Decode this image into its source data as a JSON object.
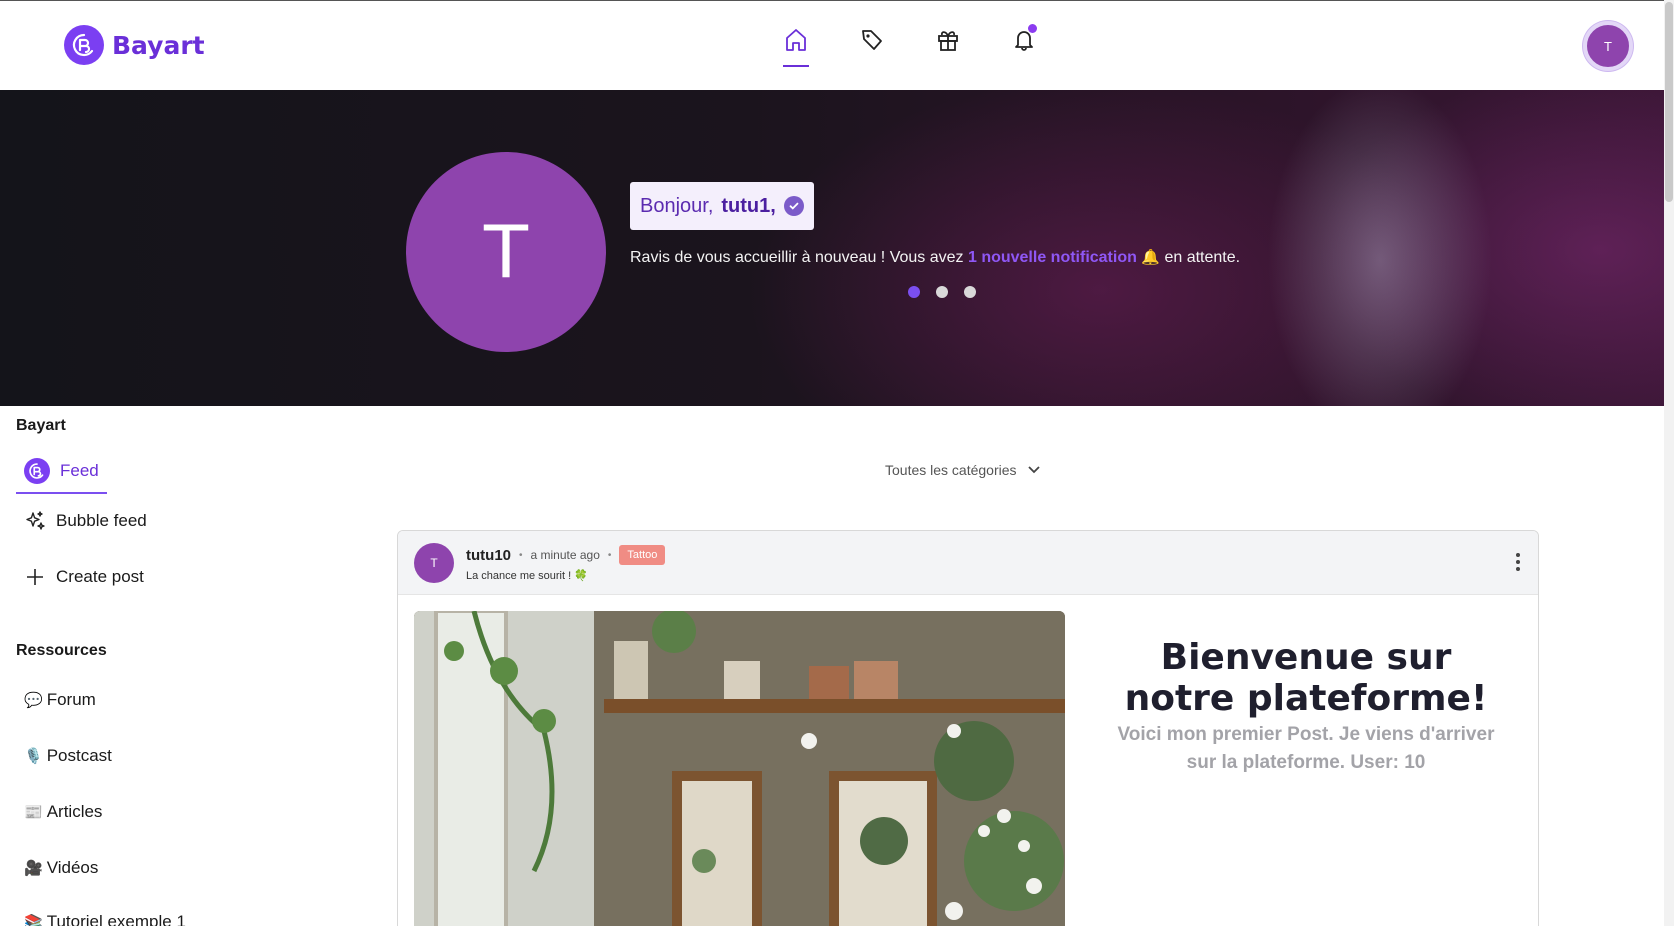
{
  "brand": {
    "name": "Bayart"
  },
  "nav": {
    "icons": [
      "home-icon",
      "tag-icon",
      "gift-icon",
      "bell-icon"
    ],
    "active": "home-icon",
    "has_notification": true
  },
  "user": {
    "initial": "T"
  },
  "hero": {
    "avatar_initial": "T",
    "greeting_prefix": "Bonjour,",
    "greeting_name": "tutu1,",
    "message_before": "Ravis de vous accueillir à nouveau ! Vous avez ",
    "message_highlight": "1 nouvelle notification",
    "message_after": " en attente.",
    "bell_emoji": "🔔",
    "carousel_active_index": 0,
    "carousel_count": 3
  },
  "sidebar": {
    "section1_title": "Bayart",
    "feed_label": "Feed",
    "bubble_feed_label": "Bubble feed",
    "create_post_label": "Create post",
    "section2_title": "Ressources",
    "resources": [
      {
        "emoji": "💬",
        "label": "Forum"
      },
      {
        "emoji": "🎙️",
        "label": "Postcast"
      },
      {
        "emoji": "📰",
        "label": "Articles"
      },
      {
        "emoji": "🎥",
        "label": "Vidéos"
      },
      {
        "emoji": "📚",
        "label": "Tutoriel exemple 1"
      }
    ]
  },
  "filter": {
    "category_label": "Toutes les catégories"
  },
  "post": {
    "avatar_initial": "T",
    "author": "tutu10",
    "time": "a minute ago",
    "tag": "Tattoo",
    "mood": "La chance me sourit ! 🍀",
    "title": "Bienvenue sur notre plateforme!",
    "body": "Voici mon premier Post. Je viens d'arriver sur la plateforme. User: 10"
  },
  "colors": {
    "accent": "#6a2fd8",
    "avatar": "#8e44ad",
    "tag": "#f08c84"
  }
}
